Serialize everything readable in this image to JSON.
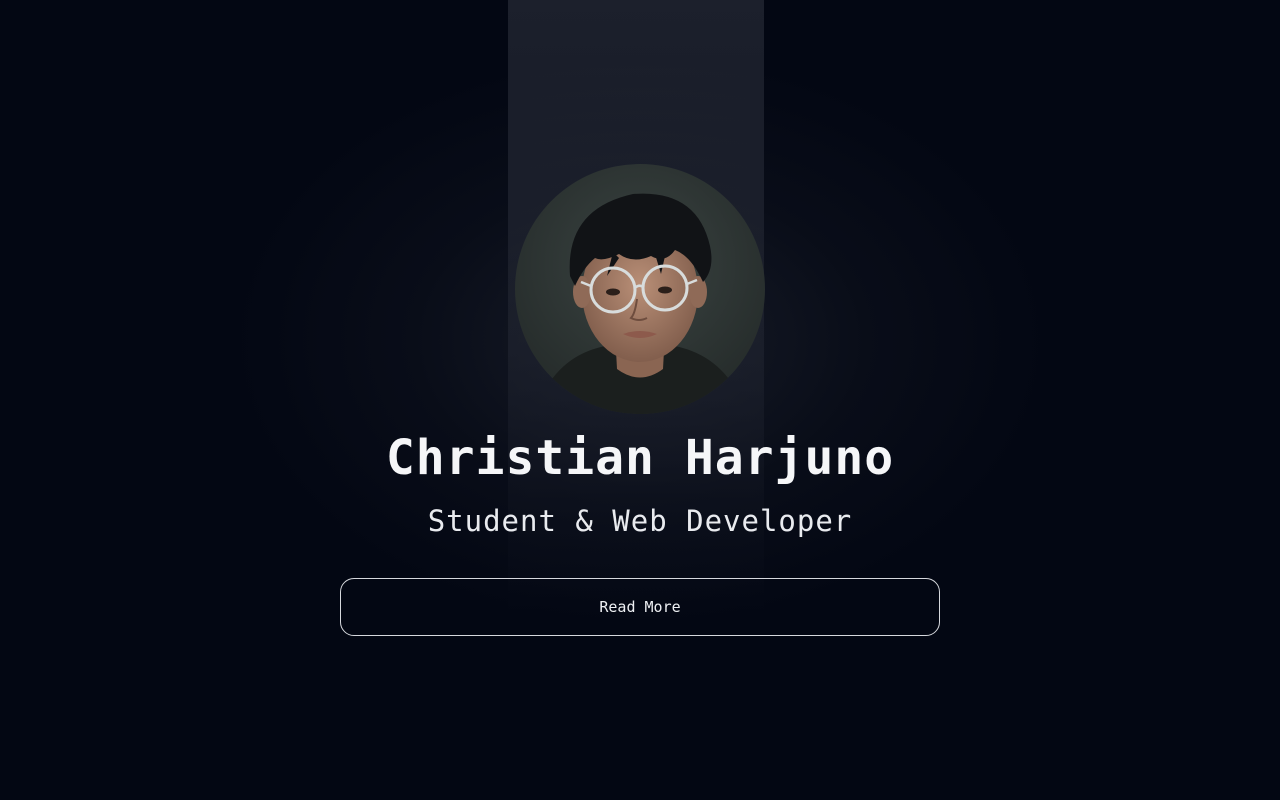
{
  "profile": {
    "name": "Christian Harjuno",
    "role": "Student & Web Developer",
    "avatar_alt": "portrait photo"
  },
  "actions": {
    "read_more_label": "Read More"
  },
  "colors": {
    "background": "#030713",
    "text": "#f5f6f8",
    "button_border": "#d6d8dd"
  }
}
